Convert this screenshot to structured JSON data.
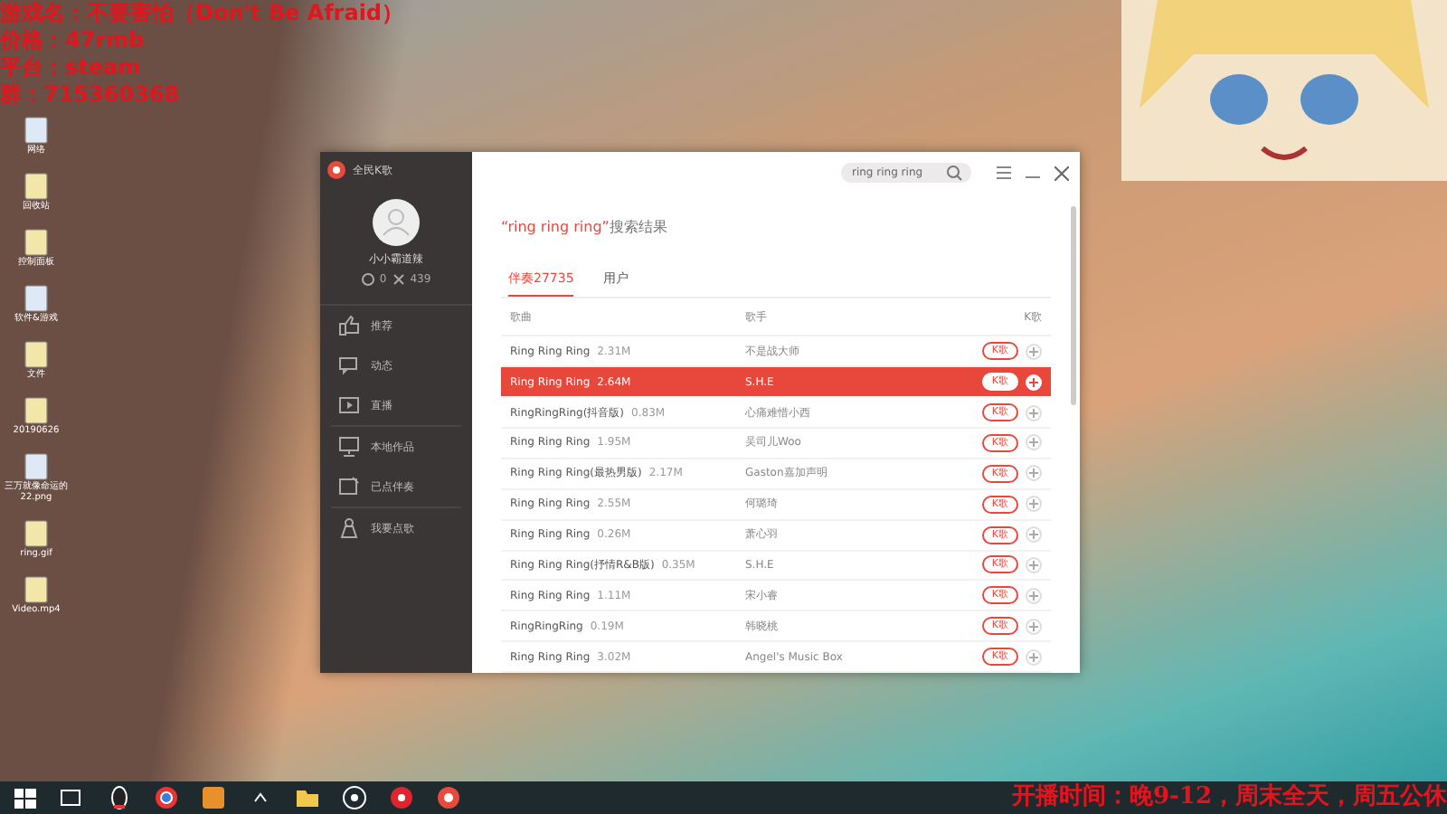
{
  "overlay": {
    "lines": [
      "游戏名：不要害怕（Don't Be Afraid）",
      "价格：47rmb",
      "平台：steam",
      "群：715360368"
    ],
    "schedule": "开播时间：晚9-12，周末全天，周五公休"
  },
  "desktop_icons": [
    {
      "label": "网络"
    },
    {
      "label": "回收站"
    },
    {
      "label": "控制面板"
    },
    {
      "label": "软件&游戏"
    },
    {
      "label": "文件"
    },
    {
      "label": "20190626"
    },
    {
      "label": "三万就像命运的22.png"
    },
    {
      "label": "ring.gif"
    },
    {
      "label": "Video.mp4"
    }
  ],
  "window": {
    "title": "全民K歌",
    "search": {
      "value": "ring ring ring"
    }
  },
  "profile": {
    "username": "小小霸道辣",
    "followers": "0",
    "likes": "439"
  },
  "sidebar": {
    "items": [
      {
        "label": "推荐",
        "selected": false
      },
      {
        "label": "动态",
        "selected": false
      },
      {
        "label": "直播",
        "selected": false
      },
      {
        "label": "本地作品",
        "selected": false
      },
      {
        "label": "已点伴奏",
        "selected": false
      },
      {
        "label": "我要点歌",
        "selected": false
      }
    ]
  },
  "heading": {
    "query": "“ring ring ring”",
    "suffix": "搜索结果"
  },
  "tabs": [
    {
      "label": "伴奏27735",
      "selected": true
    },
    {
      "label": "用户",
      "selected": false
    }
  ],
  "table": {
    "columns": [
      "歌曲",
      "歌手",
      "K歌"
    ],
    "rows": [
      {
        "song": "Ring Ring Ring",
        "size": "2.31M",
        "singer": "不是战大师",
        "action": "K歌",
        "selected": false
      },
      {
        "song": "Ring Ring Ring",
        "size": "2.64M",
        "singer": "S.H.E",
        "action": "K歌",
        "selected": true
      },
      {
        "song": "RingRingRing(抖音版)",
        "size": "0.83M",
        "singer": "心痛难惜小西",
        "action": "K歌",
        "selected": false
      },
      {
        "song": "Ring Ring Ring",
        "size": "1.95M",
        "singer": "吴司儿Woo",
        "action": "K歌",
        "selected": false
      },
      {
        "song": "Ring Ring Ring(最热男版)",
        "size": "2.17M",
        "singer": "Gaston嘉加声明",
        "action": "K歌",
        "selected": false
      },
      {
        "song": "Ring Ring Ring",
        "size": "2.55M",
        "singer": "何璐琦",
        "action": "K歌",
        "selected": false
      },
      {
        "song": "Ring Ring Ring",
        "size": "0.26M",
        "singer": "萧心羽",
        "action": "K歌",
        "selected": false
      },
      {
        "song": "Ring Ring Ring(抒情R&B版)",
        "size": "0.35M",
        "singer": "S.H.E",
        "action": "K歌",
        "selected": false
      },
      {
        "song": "Ring Ring Ring",
        "size": "1.11M",
        "singer": "宋小睿",
        "action": "K歌",
        "selected": false
      },
      {
        "song": "RingRingRing",
        "size": "0.19M",
        "singer": "韩晓桃",
        "action": "K歌",
        "selected": false
      },
      {
        "song": "Ring Ring Ring",
        "size": "3.02M",
        "singer": "Angel's Music Box",
        "action": "K歌",
        "selected": false
      }
    ]
  }
}
